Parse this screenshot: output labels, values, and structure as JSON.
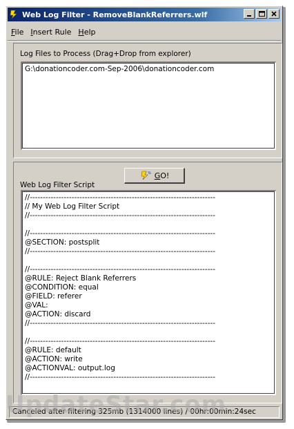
{
  "window": {
    "title": "Web Log Filter - RemoveBlankReferrers.wlf",
    "controls": {
      "minimize": "minimize",
      "maximize": "maximize",
      "close": "close"
    }
  },
  "menu": [
    {
      "accel": "F",
      "rest": "ile"
    },
    {
      "accel": "I",
      "rest": "nsert Rule"
    },
    {
      "accel": "H",
      "rest": "elp"
    }
  ],
  "files_panel": {
    "label": "Log Files to Process (Drag+Drop from explorer)",
    "files": [
      "G:\\donationcoder.com-Sep-2006\\donationcoder.com"
    ]
  },
  "script_panel": {
    "label": "Web Log Filter Script",
    "go_button": {
      "accel": "G",
      "rest": "O!"
    },
    "lines": [
      "//-----------------------------------------------------------------------",
      "// My Web Log Filter Script",
      "//-----------------------------------------------------------------------",
      "",
      "//-----------------------------------------------------------------------",
      "@SECTION: postsplit",
      "//-----------------------------------------------------------------------",
      "",
      "//-----------------------------------------------------------------------",
      "@RULE: Reject Blank Referrers",
      "@CONDITION: equal",
      "@FIELD: referer",
      "@VAL:",
      "@ACTION: discard",
      "//-----------------------------------------------------------------------",
      "",
      "//-----------------------------------------------------------------------",
      "@RULE: default",
      "@ACTION: write",
      "@ACTIONVAL: output.log",
      "//-----------------------------------------------------------------------"
    ]
  },
  "status": "Canceled after filtering 325mb (1314000 lines) / 00hr:00min:24sec",
  "watermark": "UpdateStar.com"
}
